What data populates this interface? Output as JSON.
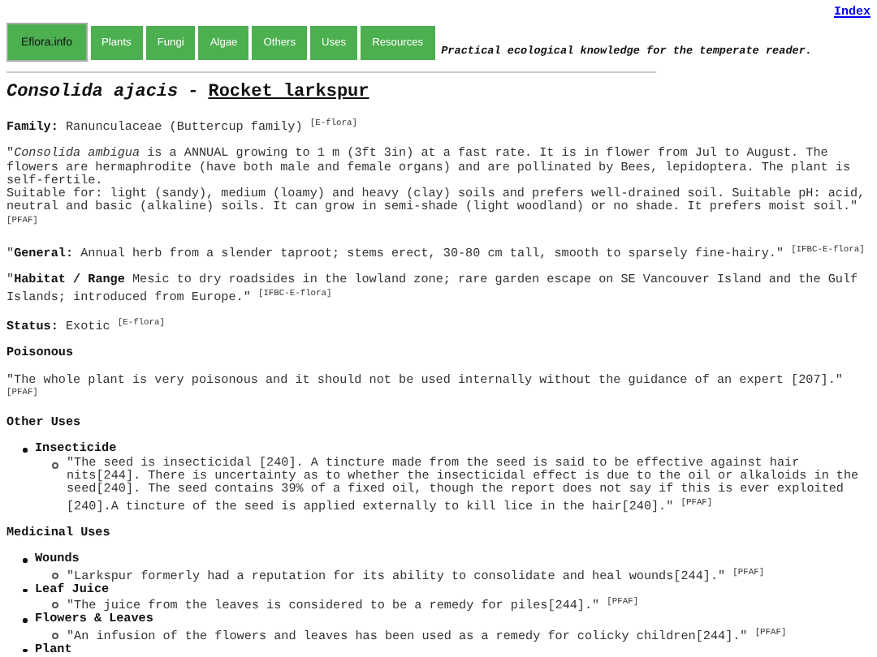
{
  "index_link": "Index",
  "nav": [
    {
      "label": "Eflora.info",
      "selected": true
    },
    {
      "label": "Plants",
      "selected": false
    },
    {
      "label": "Fungi",
      "selected": false
    },
    {
      "label": "Algae",
      "selected": false
    },
    {
      "label": "Others",
      "selected": false
    },
    {
      "label": "Uses",
      "selected": false
    },
    {
      "label": "Resources",
      "selected": false
    }
  ],
  "tagline": "Practical ecological knowledge for the temperate reader.",
  "title": {
    "latin": "Consolida ajacis",
    "separator": "-",
    "common": "Rocket larkspur"
  },
  "blocks": [
    {
      "kind": "paragraph",
      "lines": [
        "**Family:** Ranunculaceae (Buttercup family) $^{[E-flora]}$"
      ]
    },
    {
      "kind": "paragraph",
      "lines": [
        "\"*Consolida ambigua* is a ANNUAL growing to 1 m (3ft 3in) at a fast rate. It is in flower from Jul to August. The flowers are hermaphrodite (have both male and female organs) and are pollinated by Bees, lepidoptera. The plant is self-fertile.",
        "Suitable for: light (sandy), medium (loamy) and heavy (clay) soils and prefers well-drained soil. Suitable pH: acid, neutral and basic (alkaline) soils. It can grow in semi-shade (light woodland) or no shade. It prefers moist soil.\" $^{[PFAF]}$"
      ]
    },
    {
      "kind": "paragraph",
      "lines": [
        "\"**General:** Annual herb from a slender taproot; stems erect, 30-80 cm tall, smooth to sparsely fine-hairy.\" $^{[IFBC-E-flora]}$"
      ]
    },
    {
      "kind": "paragraph",
      "lines": [
        "\"**Habitat / Range** Mesic to dry roadsides in the lowland zone; rare garden escape on SE Vancouver Island and the Gulf Islands; introduced from Europe.\" $^{[IFBC-E-flora]}$"
      ]
    },
    {
      "kind": "paragraph",
      "lines": [
        "**Status:** Exotic $^{[E-flora]}$"
      ]
    },
    {
      "kind": "heading",
      "text": "Poisonous"
    },
    {
      "kind": "paragraph",
      "lines": [
        "\"The whole plant is very poisonous and it should not be used internally without the guidance of an expert [207].\" $^{[PFAF]}$"
      ]
    },
    {
      "kind": "heading",
      "text": "Other Uses"
    },
    {
      "kind": "uses",
      "items": [
        {
          "name": "Insecticide",
          "notes": [
            "\"The seed is insecticidal [240]. A tincture made from the seed is said to be effective against hair nits[244]. There is uncertainty as to whether the insecticidal effect is due to the oil or alkaloids in the seed[240]. The seed contains 39% of a fixed oil, though the report does not say if this is ever exploited [240].A tincture of the seed is applied externally to kill lice in the hair[240].\" $^{[PFAF]}$"
          ]
        }
      ]
    },
    {
      "kind": "heading",
      "text": "Medicinal Uses"
    },
    {
      "kind": "uses",
      "items": [
        {
          "name": "Wounds",
          "notes": [
            "\"Larkspur formerly had a reputation for its ability to consolidate and heal wounds[244].\" $^{[PFAF]}$"
          ]
        },
        {
          "name": "Leaf Juice",
          "notes": [
            "\"The juice from the leaves is considered to be a remedy for piles[244].\" $^{[PFAF]}$"
          ]
        },
        {
          "name": "Flowers & Leaves",
          "notes": [
            "\"An infusion of the flowers and leaves has been used as a remedy for colicky children[244].\" $^{[PFAF]}$"
          ]
        },
        {
          "name": "Plant"
        }
      ]
    }
  ]
}
